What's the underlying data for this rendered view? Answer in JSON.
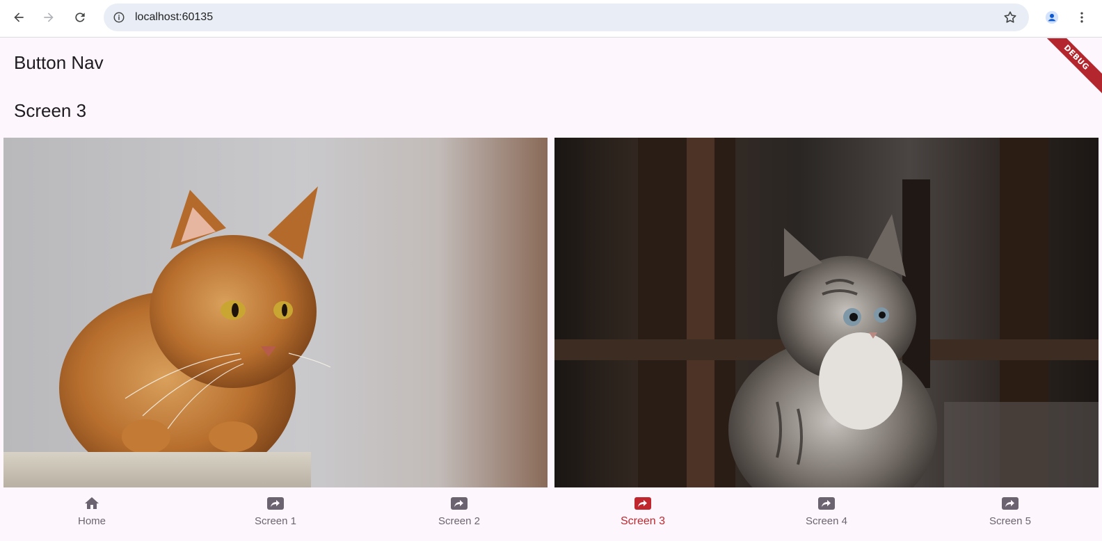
{
  "browser": {
    "url": "localhost:60135",
    "icons": {
      "back": "arrow-left-icon",
      "forward": "arrow-right-icon",
      "reload": "reload-icon",
      "info": "info-icon",
      "bookmark": "star-icon",
      "profile": "account-icon",
      "menu": "more-vert-icon"
    }
  },
  "app": {
    "title": "Button Nav",
    "debug_banner": "DEBUG",
    "screen_title": "Screen 3"
  },
  "bottom_nav": {
    "active_color": "#c0262d",
    "inactive_color": "#6b6470",
    "selected_index": 3,
    "items": [
      {
        "label": "Home",
        "icon": "home-icon"
      },
      {
        "label": "Screen 1",
        "icon": "share-icon"
      },
      {
        "label": "Screen 2",
        "icon": "share-icon"
      },
      {
        "label": "Screen 3",
        "icon": "share-icon"
      },
      {
        "label": "Screen 4",
        "icon": "share-icon"
      },
      {
        "label": "Screen 5",
        "icon": "share-icon"
      }
    ]
  }
}
